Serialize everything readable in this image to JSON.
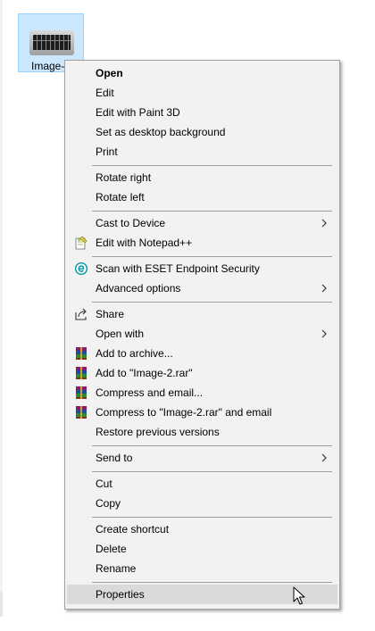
{
  "desktop": {
    "file_label": "Image-"
  },
  "menu": {
    "open": "Open",
    "edit": "Edit",
    "edit_paint3d": "Edit with Paint 3D",
    "set_background": "Set as desktop background",
    "print": "Print",
    "rotate_right": "Rotate right",
    "rotate_left": "Rotate left",
    "cast_to_device": "Cast to Device",
    "edit_notepadpp": "Edit with Notepad++",
    "scan_eset": "Scan with ESET Endpoint Security",
    "advanced_options": "Advanced options",
    "share": "Share",
    "open_with": "Open with",
    "add_to_archive": "Add to archive...",
    "add_to_rar": "Add to \"Image-2.rar\"",
    "compress_email": "Compress and email...",
    "compress_rar_email": "Compress to \"Image-2.rar\" and email",
    "restore_versions": "Restore previous versions",
    "send_to": "Send to",
    "cut": "Cut",
    "copy": "Copy",
    "create_shortcut": "Create shortcut",
    "delete": "Delete",
    "rename": "Rename",
    "properties": "Properties"
  },
  "icons": {
    "notepadpp": "notepad-plus-plus-icon",
    "eset": "eset-icon",
    "share": "share-icon",
    "winrar": "winrar-icon",
    "submenu": "chevron-right-icon"
  },
  "colors": {
    "selection_bg": "#cce8ff",
    "menu_bg": "#f2f2f2",
    "hover_bg": "#dadada",
    "eset_teal": "#0096a6"
  }
}
